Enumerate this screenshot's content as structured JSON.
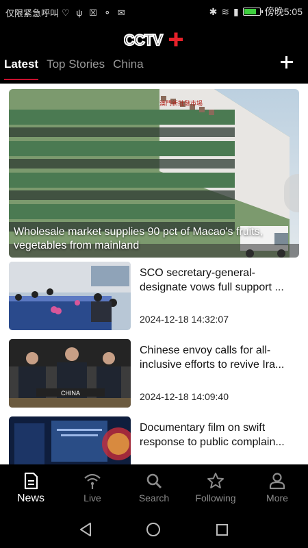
{
  "status_bar": {
    "carrier_text": "仅限紧急呼叫",
    "operator": "傍晚",
    "time": "5:05"
  },
  "header": {
    "logo_alt": "CCTV+",
    "tabs": [
      {
        "label": "Latest",
        "active": true
      },
      {
        "label": "Top Stories",
        "active": false
      },
      {
        "label": "China",
        "active": false
      }
    ]
  },
  "hero": {
    "title": "Wholesale market supplies 90 pct of Macao's fruits, vegetables from mainland",
    "sign_text": "澳門新批發市場"
  },
  "articles": [
    {
      "title": "SCO secretary-general-designate vows full support ...",
      "time": "2024-12-18 14:32:07"
    },
    {
      "title": "Chinese envoy calls for all-inclusive efforts to revive Ira...",
      "time": "2024-12-18 14:09:40",
      "placard": "CHINA"
    },
    {
      "title": "Documentary film on swift response to public complain...",
      "time": ""
    }
  ],
  "bottom_nav": [
    {
      "label": "News",
      "icon": "news-icon",
      "active": true
    },
    {
      "label": "Live",
      "icon": "live-icon",
      "active": false
    },
    {
      "label": "Search",
      "icon": "search-icon",
      "active": false
    },
    {
      "label": "Following",
      "icon": "star-icon",
      "active": false
    },
    {
      "label": "More",
      "icon": "person-icon",
      "active": false
    }
  ],
  "colors": {
    "accent": "#c8102e",
    "background": "#000000",
    "content_bg": "#ffffff"
  }
}
